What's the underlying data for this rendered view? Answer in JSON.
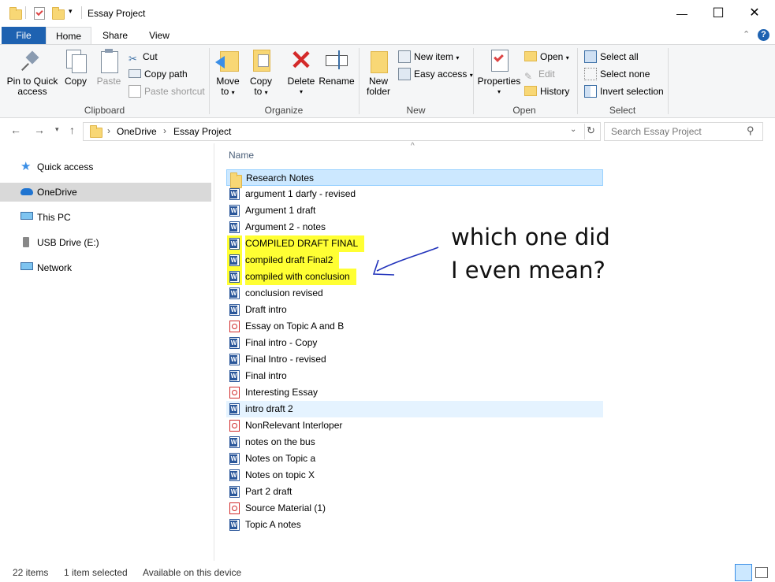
{
  "window": {
    "title": "Essay Project",
    "min_glyph": "—",
    "max_glyph": "☐",
    "close_glyph": "✕"
  },
  "tabs": {
    "file": "File",
    "home": "Home",
    "share": "Share",
    "view": "View"
  },
  "ribbon": {
    "clipboard": {
      "label": "Clipboard",
      "pin_line1": "Pin to Quick",
      "pin_line2": "access",
      "copy": "Copy",
      "paste": "Paste",
      "cut": "Cut",
      "copy_path": "Copy path",
      "paste_shortcut": "Paste shortcut"
    },
    "organize": {
      "label": "Organize",
      "move_to_line1": "Move",
      "move_to_line2": "to",
      "copy_to_line1": "Copy",
      "copy_to_line2": "to",
      "delete": "Delete",
      "rename": "Rename"
    },
    "new": {
      "label": "New",
      "new_folder_line1": "New",
      "new_folder_line2": "folder",
      "new_item": "New item",
      "easy_access": "Easy access"
    },
    "open": {
      "label": "Open",
      "properties": "Properties",
      "open": "Open",
      "edit": "Edit",
      "history": "History"
    },
    "select": {
      "label": "Select",
      "select_all": "Select all",
      "select_none": "Select none",
      "invert": "Invert selection"
    }
  },
  "address": {
    "crumb1": "OneDrive",
    "crumb2": "Essay Project",
    "search_placeholder": "Search Essay Project"
  },
  "nav": {
    "quick_access": "Quick access",
    "onedrive": "OneDrive",
    "this_pc": "This PC",
    "usb": "USB Drive (E:)",
    "network": "Network"
  },
  "list": {
    "column_name": "Name",
    "files": [
      {
        "name": "Research Notes",
        "type": "folder"
      },
      {
        "name": "argument 1 darfy - revised",
        "type": "word"
      },
      {
        "name": "Argument 1 draft",
        "type": "word"
      },
      {
        "name": "Argument 2 - notes",
        "type": "word"
      },
      {
        "name": "COMPILED DRAFT FINAL",
        "type": "word",
        "highlight": true
      },
      {
        "name": "compiled draft Final2",
        "type": "word",
        "highlight": true
      },
      {
        "name": "compiled with conclusion",
        "type": "word",
        "highlight": true
      },
      {
        "name": "conclusion revised",
        "type": "word"
      },
      {
        "name": "Draft intro",
        "type": "word"
      },
      {
        "name": "Essay on Topic A and B",
        "type": "pdf"
      },
      {
        "name": "Final intro - Copy",
        "type": "word"
      },
      {
        "name": "Final Intro - revised",
        "type": "word"
      },
      {
        "name": "Final intro",
        "type": "word"
      },
      {
        "name": "Interesting Essay",
        "type": "pdf"
      },
      {
        "name": "intro draft 2",
        "type": "word"
      },
      {
        "name": "NonRelevant Interloper",
        "type": "pdf"
      },
      {
        "name": "notes on the bus",
        "type": "word"
      },
      {
        "name": "Notes on Topic a",
        "type": "word"
      },
      {
        "name": "Notes on topic X",
        "type": "word"
      },
      {
        "name": "Part 2 draft",
        "type": "word"
      },
      {
        "name": "Source Material (1)",
        "type": "pdf"
      },
      {
        "name": "Topic A notes",
        "type": "word"
      }
    ]
  },
  "annotation": {
    "line1": "which one did",
    "line2": "I even mean?"
  },
  "status": {
    "items": "22 items",
    "selected": "1 item selected",
    "availability": "Available on this device"
  },
  "colors": {
    "accent": "#1e62b1",
    "highlight": "#ffff33",
    "selection": "#cce8ff",
    "hover": "#e5f3ff",
    "annotation_arrow": "#2233bb"
  }
}
